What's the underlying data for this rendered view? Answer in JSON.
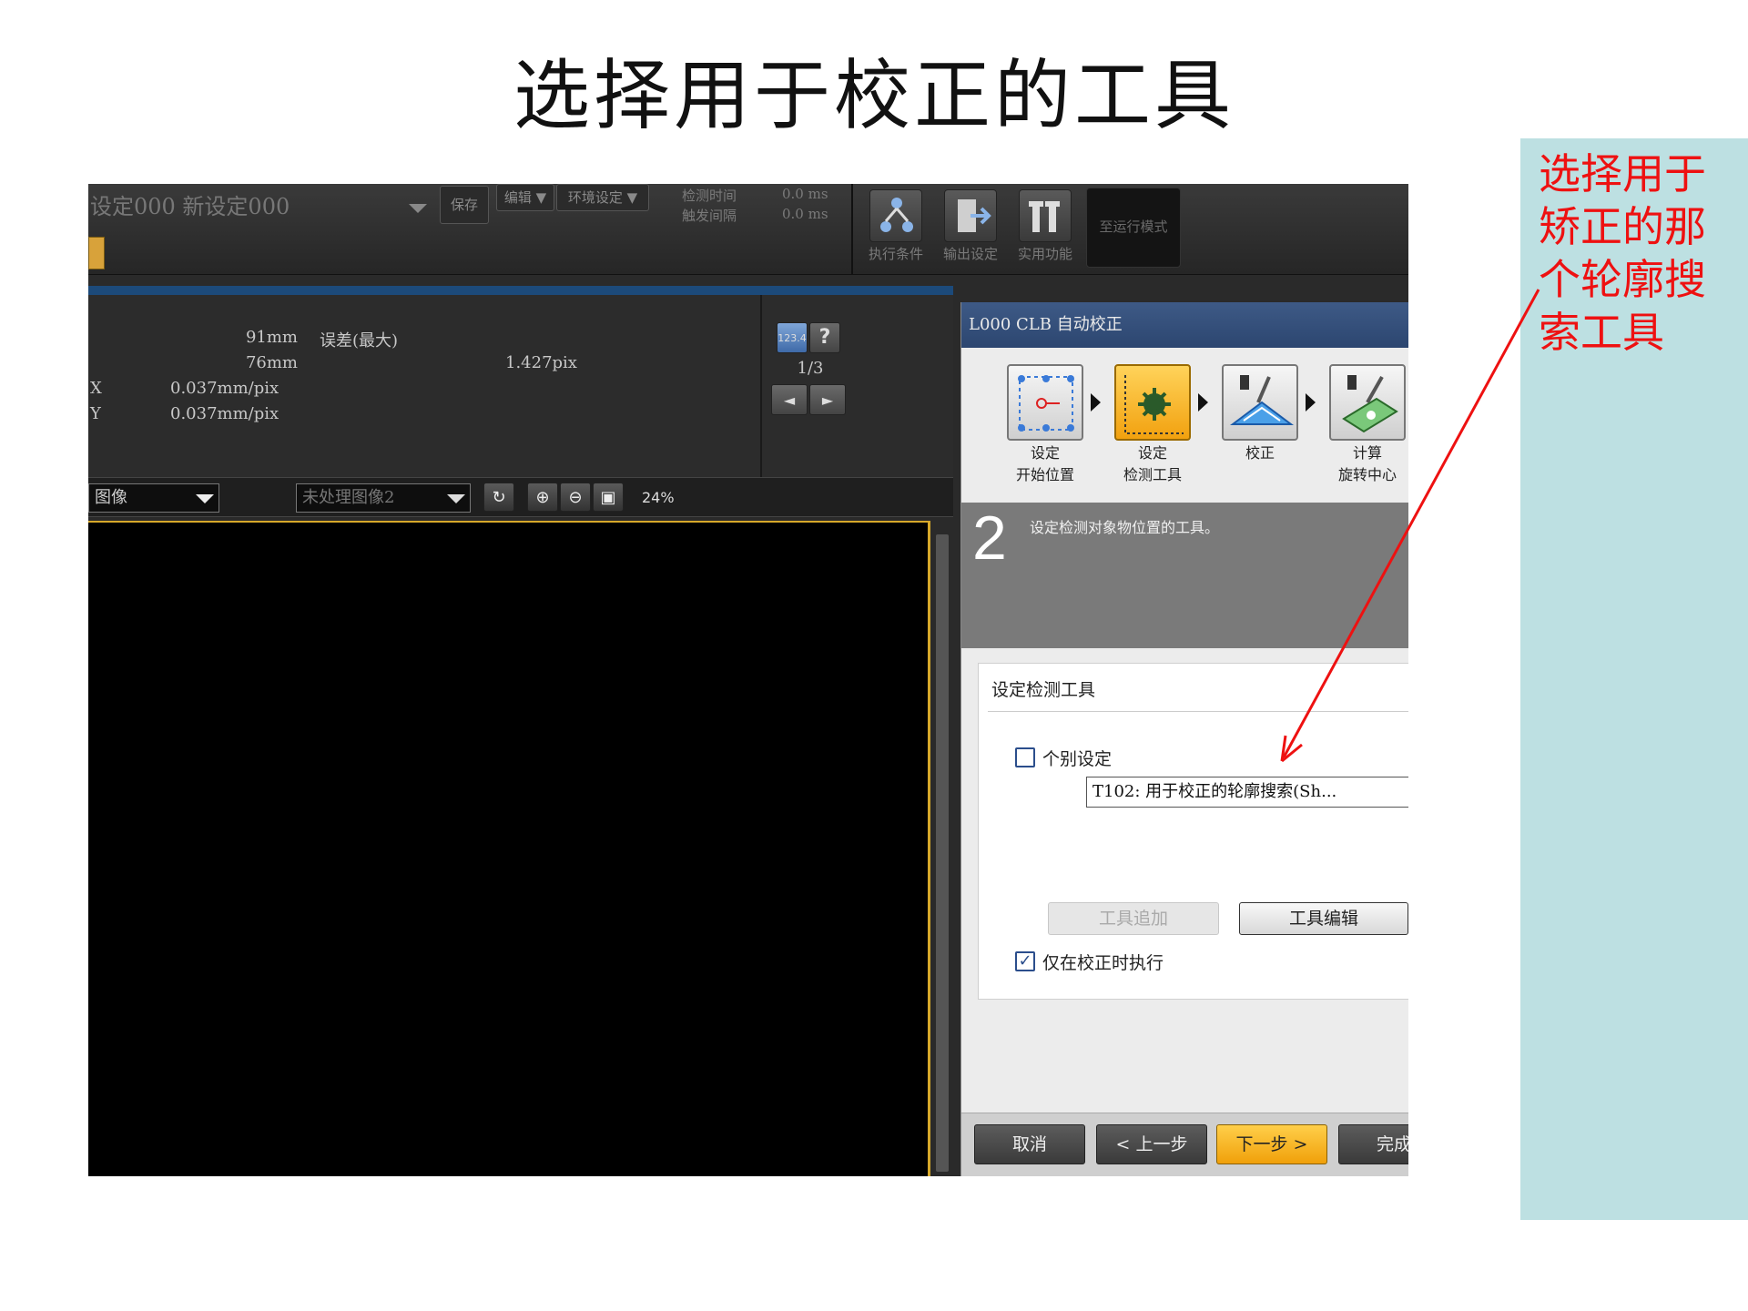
{
  "slide": {
    "title": "选择用于校正的工具",
    "annotation": "选择用于矫正的那个轮廓搜索工具"
  },
  "topbar": {
    "setting_name": "设定000 新设定000",
    "save_label": "保存",
    "edit_label": "编辑",
    "env_label": "环境设定",
    "detect_time_label": "检测时间",
    "trigger_interval_label": "触发间隔",
    "detect_time_value": "0.0 ms",
    "trigger_interval_value": "0.0 ms",
    "exec_condition_label": "执行条件",
    "output_setting_label": "输出设定",
    "utility_label": "实用功能",
    "run_mode_label": "至运行模式"
  },
  "info": {
    "row1_value": "91mm",
    "row1_label": "误差(最大)",
    "row2_value": "76mm",
    "row2_error": "1.427pix",
    "row3_label": "X",
    "row3_value": "0.037mm/pix",
    "row4_label": "Y",
    "row4_value": "0.037mm/pix",
    "numbtn_label": "123.4",
    "help_label": "?",
    "page": "1/3",
    "prev_label": "◄",
    "next_label": "►"
  },
  "imagebar": {
    "image_select": "图像",
    "raw_select": "未处理图像2",
    "refresh_icon": "↻",
    "zoom_in_icon": "⊕",
    "zoom_out_icon": "⊖",
    "fit_icon": "▣",
    "zoom": "24%"
  },
  "dialog": {
    "title": "L000 CLB 自动校正",
    "steps": [
      {
        "label1": "设定",
        "label2": "开始位置"
      },
      {
        "label1": "设定",
        "label2": "检测工具"
      },
      {
        "label1": "校正",
        "label2": ""
      },
      {
        "label1": "计算",
        "label2": "旋转中心"
      }
    ],
    "step_number": "2",
    "step_desc": "设定检测对象物位置的工具。",
    "section_title": "设定检测工具",
    "individual_label": "个别设定",
    "tool_value": "T102: 用于校正的轮廓搜索(Sh...",
    "add_tool_label": "工具追加",
    "edit_tool_label": "工具编辑",
    "only_calib_label": "仅在校正时执行",
    "check_mark": "✓",
    "cancel_label": "取消",
    "back_label": "< 上一步",
    "next_label": "下一步 >",
    "finish_label": "完成"
  },
  "colors": {
    "accent": "#f2a10f",
    "annotation": "#ee1111",
    "side_panel": "#bde0e2",
    "dialog_title": "#2c4670"
  }
}
